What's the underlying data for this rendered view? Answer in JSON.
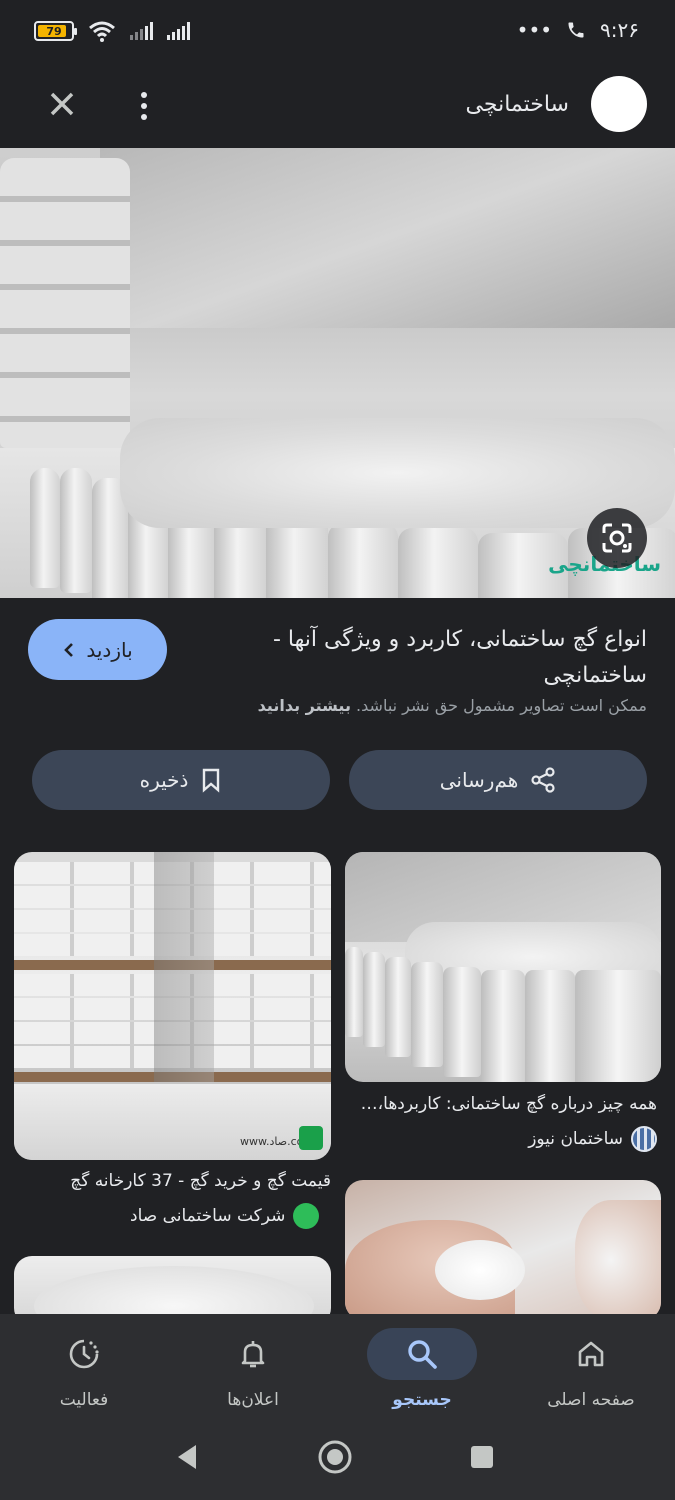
{
  "status_bar": {
    "battery": "79",
    "battery_level": 0.79,
    "dots": "•••",
    "time": "۹:۲۶"
  },
  "top_bar": {
    "site_name": "ساختمانچی"
  },
  "result": {
    "visit_label": "بازدید",
    "title": "انواع گچ ساختمانی، کاربرد و ویژگی آنها - ساختمانچی",
    "notice_text": "ممکن است تصاویر مشمول حق نشر نباشد.",
    "notice_link": "بیشتر بدانید",
    "watermark": "ساختمانچی"
  },
  "actions": {
    "share_label": "هم‌رسانی",
    "save_label": "ذخیره"
  },
  "related": [
    {
      "caption": "همه چیز درباره گچ ساختمانی: کاربردها،…",
      "source": "ساختمان نیوز"
    },
    {
      "caption": "قیمت گچ و خرید گچ - 37 کارخانه گچ",
      "source": "شرکت ساختمانی صاد"
    }
  ],
  "thumb_watermark": "www.صاد.com",
  "bottom_nav": [
    {
      "label": "صفحه اصلی",
      "icon": "home-icon"
    },
    {
      "label": "جستجو",
      "icon": "search-icon",
      "active": true
    },
    {
      "label": "اعلان‌ها",
      "icon": "bell-icon"
    },
    {
      "label": "فعالیت",
      "icon": "activity-icon"
    }
  ],
  "colors": {
    "background": "#202124",
    "accent": "#8ab4f8",
    "button_bg": "#3c4657",
    "nav_bg": "#2d2e31",
    "active_label": "#a8c7fa"
  }
}
